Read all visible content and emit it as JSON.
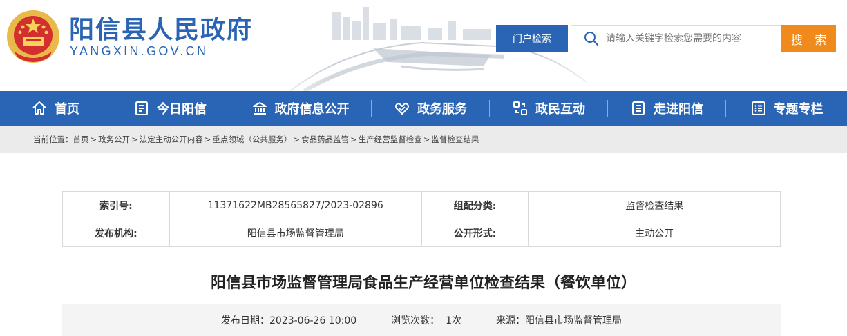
{
  "header": {
    "site_title": "阳信县人民政府",
    "site_domain": "YANGXIN.GOV.CN",
    "portal_search_label": "门户检索",
    "search_placeholder": "请输入关键字检索您需要的内容",
    "search_button": "搜 索"
  },
  "nav": {
    "items": [
      {
        "label": "首页",
        "icon": "home-icon"
      },
      {
        "label": "今日阳信",
        "icon": "news-icon"
      },
      {
        "label": "政府信息公开",
        "icon": "building-icon"
      },
      {
        "label": "政务服务",
        "icon": "handshake-icon"
      },
      {
        "label": "政民互动",
        "icon": "interaction-icon"
      },
      {
        "label": "走进阳信",
        "icon": "book-icon"
      },
      {
        "label": "专题专栏",
        "icon": "list-icon"
      }
    ]
  },
  "breadcrumb": {
    "prefix": "当前位置：",
    "items": [
      "首页",
      "政务公开",
      "法定主动公开内容",
      "重点领域（公共服务）",
      "食品药品监管",
      "生产经营监督检查",
      "监督检查结果"
    ],
    "separator": ">"
  },
  "info": {
    "index_label": "索引号:",
    "index_value": "11371622MB28565827/2023-02896",
    "category_label": "组配分类:",
    "category_value": "监督检查结果",
    "publisher_label": "发布机构:",
    "publisher_value": "阳信县市场监督管理局",
    "disclosure_label": "公开形式:",
    "disclosure_value": "主动公开"
  },
  "article": {
    "title": "阳信县市场监督管理局食品生产经营单位检查结果（餐饮单位）",
    "date": "发布日期：2023-06-26 10:00",
    "views": "浏览次数：  1次",
    "source": "来源：阳信县市场监督管理局"
  },
  "colors": {
    "brand_blue": "#2a64b4",
    "search_orange": "#f08a1c"
  }
}
